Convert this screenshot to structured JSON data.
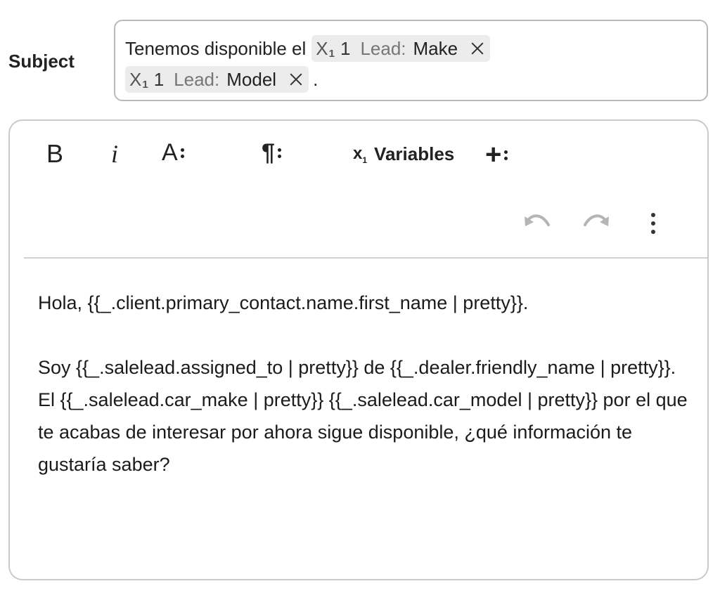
{
  "subject": {
    "label": "Subject",
    "text_before": "Tenemos disponible el",
    "chips": [
      {
        "icon": "variable-icon",
        "icon_letter": "X",
        "icon_sub": "1",
        "count": "1",
        "prefix": "Lead:",
        "name": "Make"
      },
      {
        "icon": "variable-icon",
        "icon_letter": "X",
        "icon_sub": "1",
        "count": "1",
        "prefix": "Lead:",
        "name": "Model"
      }
    ],
    "text_after": "."
  },
  "toolbar": {
    "bold_label": "B",
    "italic_label": "i",
    "font_label": "A",
    "paragraph_label": "¶",
    "variables_symbol": "x",
    "variables_sub": "1",
    "variables_label": "Variables",
    "insert_label": "+",
    "icons": [
      "bold-icon",
      "italic-icon",
      "font-icon",
      "paragraph-icon",
      "variables-icon",
      "insert-icon",
      "undo-icon",
      "redo-icon",
      "more-vertical-icon"
    ]
  },
  "body": {
    "greeting": "Hola, {{_.client.primary_contact.name.first_name | pretty}}.",
    "paragraph": "Soy {{_.salelead.assigned_to | pretty}} de {{_.dealer.friendly_name | pretty}}. El {{_.salelead.car_make | pretty}} {{_.salelead.car_model | pretty}} por el que te acabas de interesar por ahora sigue disponible, ¿qué información te gustaría saber?"
  },
  "colors": {
    "border": "#b9b9b9",
    "chip_bg": "#ececec",
    "disabled_icon": "#b5b5b5",
    "text": "#1b1b1b"
  }
}
